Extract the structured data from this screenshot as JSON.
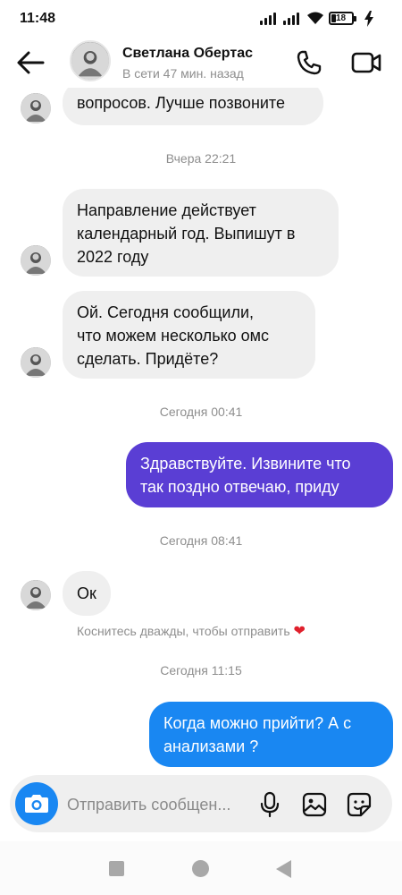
{
  "status_bar": {
    "time": "11:48",
    "battery_level": "18"
  },
  "header": {
    "contact_name": "Светлана Обертас",
    "contact_status": "В сети 47 мин. назад"
  },
  "messages": [
    {
      "type": "in",
      "lines": [
        "вопросов. Лучше позвоните"
      ]
    },
    {
      "type": "timestamp",
      "text": "Вчера 22:21"
    },
    {
      "type": "in",
      "lines": [
        "Направление действует",
        "календарный год. Выпишут в",
        "2022 году"
      ]
    },
    {
      "type": "in",
      "lines": [
        "Ой. Сегодня сообщили,",
        "что можем несколько омс",
        "сделать. Придёте?"
      ]
    },
    {
      "type": "timestamp",
      "text": "Сегодня 00:41"
    },
    {
      "type": "out",
      "lines": [
        "Здравствуйте. Извините что",
        "так поздно отвечаю, приду"
      ]
    },
    {
      "type": "timestamp",
      "text": "Сегодня 08:41"
    },
    {
      "type": "in",
      "lines": [
        "Ок"
      ]
    },
    {
      "type": "hint",
      "text": "Коснитесь дважды, чтобы отправить"
    },
    {
      "type": "timestamp",
      "text": "Сегодня 11:15"
    },
    {
      "type": "out",
      "lines": [
        "Когда можно прийти? А с",
        "анализами ?"
      ]
    }
  ],
  "composer": {
    "placeholder": "Отправить сообщен..."
  },
  "colors": {
    "accent_blue": "#1987f2",
    "accent_purple": "#5a3ed4",
    "incoming_bubble": "#efefef",
    "muted_text": "#8e8e8e",
    "heart": "#e0202c"
  },
  "icons": {
    "back": "arrow-left-icon",
    "call": "phone-icon",
    "video": "video-camera-icon",
    "camera": "camera-icon",
    "mic": "microphone-icon",
    "gallery": "image-icon",
    "sticker": "sticker-icon",
    "heart": "heart-icon"
  }
}
